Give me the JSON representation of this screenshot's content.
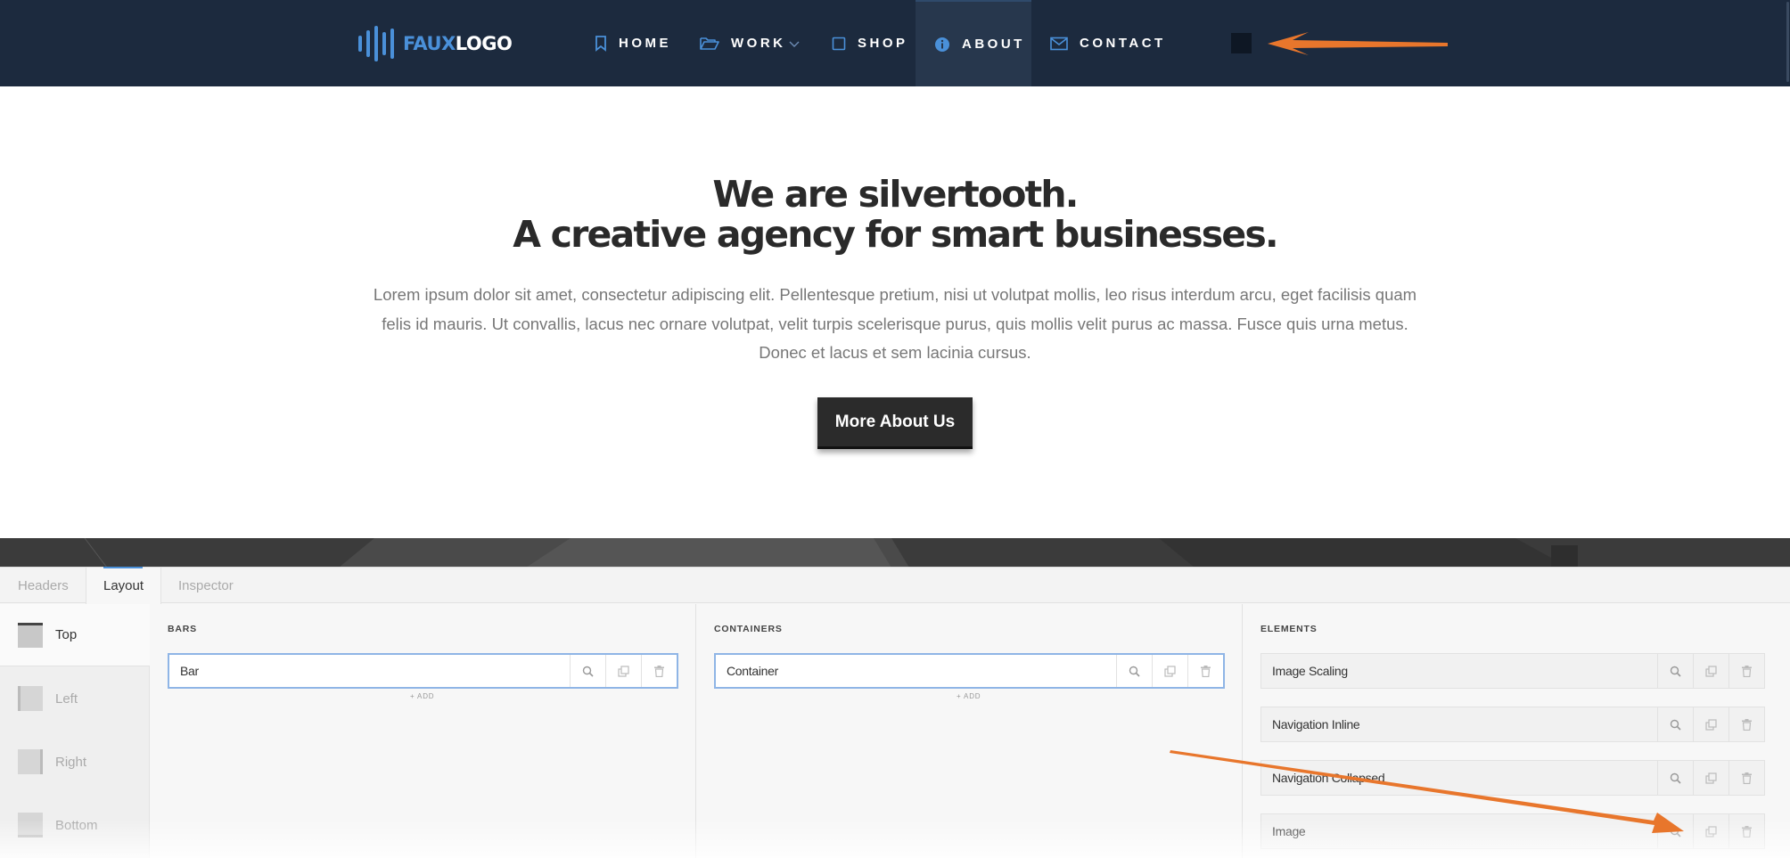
{
  "site": {
    "logo": {
      "part1": "FAUX",
      "part2": "LOGO"
    },
    "nav": [
      {
        "label": "HOME",
        "icon": "bookmark-icon"
      },
      {
        "label": "WORK",
        "icon": "folder-open-icon"
      },
      {
        "label": "SHOP",
        "icon": "square-icon"
      },
      {
        "label": "ABOUT",
        "icon": "info-circle-icon"
      },
      {
        "label": "CONTACT",
        "icon": "envelope-icon"
      }
    ],
    "active_nav": "ABOUT"
  },
  "hero": {
    "title_line1": "We are silvertooth.",
    "title_line2": "A creative agency for smart businesses.",
    "body": "Lorem ipsum dolor sit amet, consectetur adipiscing elit. Pellentesque pretium, nisi ut volutpat mollis, leo risus interdum arcu, eget facilisis quam felis id mauris. Ut convallis, lacus nec ornare volutpat, velit turpis scelerisque purus, quis mollis velit purus ac massa. Fusce quis urna metus. Donec et lacus et sem lacinia cursus.",
    "button": "More About Us"
  },
  "builder": {
    "tabs": [
      "Headers",
      "Layout",
      "Inspector"
    ],
    "active_tab": "Layout",
    "regions": [
      "Top",
      "Left",
      "Right",
      "Bottom"
    ],
    "active_region": "Top",
    "bars": {
      "title": "BARS",
      "items": [
        "Bar"
      ],
      "add_label": "+ ADD"
    },
    "containers": {
      "title": "CONTAINERS",
      "items": [
        "Container"
      ],
      "add_label": "+ ADD"
    },
    "elements": {
      "title": "ELEMENTS",
      "items": [
        "Image Scaling",
        "Navigation Inline",
        "Navigation Collapsed",
        "Image"
      ]
    }
  },
  "colors": {
    "nav_bg": "#1c2a3e",
    "logo_accent": "#4a90d9",
    "annotation_arrow": "#e8762c",
    "selected_border": "#8fb5e6"
  }
}
